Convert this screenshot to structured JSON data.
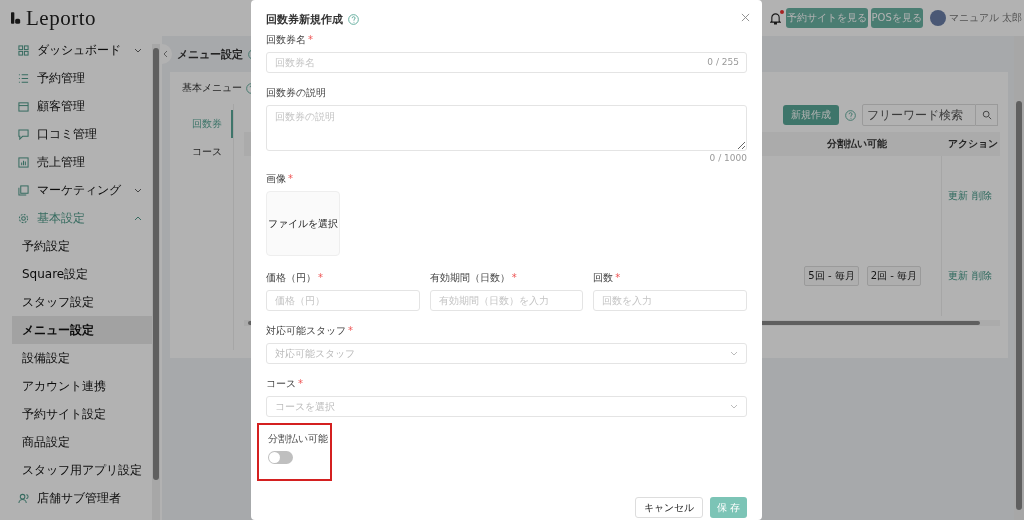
{
  "header": {
    "logo": "Leporto",
    "has_notification": true,
    "buttons": [
      "予約サイトを見る",
      "POSを見る"
    ],
    "user_name": "マニュアル 太郎"
  },
  "sidebar": {
    "items": [
      {
        "label": "ダッシュボード",
        "expandable": true,
        "expanded": false,
        "active": false
      },
      {
        "label": "予約管理",
        "expandable": false,
        "active": false
      },
      {
        "label": "顧客管理",
        "expandable": false,
        "active": false
      },
      {
        "label": "口コミ管理",
        "expandable": false,
        "active": false
      },
      {
        "label": "売上管理",
        "expandable": false,
        "active": false
      },
      {
        "label": "マーケティング",
        "expandable": true,
        "expanded": false,
        "active": false
      },
      {
        "label": "基本設定",
        "expandable": true,
        "expanded": true,
        "active": true,
        "children": [
          {
            "label": "予約設定",
            "selected": false
          },
          {
            "label": "Square設定",
            "selected": false
          },
          {
            "label": "スタッフ設定",
            "selected": false
          },
          {
            "label": "メニュー設定",
            "selected": true
          },
          {
            "label": "設備設定",
            "selected": false
          },
          {
            "label": "アカウント連携",
            "selected": false
          },
          {
            "label": "予約サイト設定",
            "selected": false
          },
          {
            "label": "商品設定",
            "selected": false
          },
          {
            "label": "スタッフ用アプリ設定",
            "selected": false
          }
        ]
      },
      {
        "label": "店舗サブ管理者",
        "expandable": false,
        "active": false
      }
    ]
  },
  "page": {
    "title": "メニュー設定",
    "section_tab": "基本メニュー",
    "tabs": [
      {
        "label": "回数券",
        "selected": true
      },
      {
        "label": "コース",
        "selected": false
      }
    ],
    "new_button": "新規作成",
    "search": {
      "placeholder": "フリーワード検索"
    },
    "table": {
      "columns": [
        "分割払い可能",
        "アクション"
      ],
      "rows": [
        {
          "installments": [],
          "actions": [
            "更新",
            "削除"
          ]
        },
        {
          "installments": [
            "5回 - 毎月",
            "2回 - 毎月"
          ],
          "actions": [
            "更新",
            "削除"
          ]
        }
      ]
    }
  },
  "dialog": {
    "title": "回数券新規作成",
    "name": {
      "label": "回数券名",
      "required_mark": "*",
      "placeholder": "回数券名",
      "counter": "0 / 255"
    },
    "description": {
      "label": "回数券の説明",
      "placeholder": "回数券の説明",
      "counter": "0 / 1000"
    },
    "image": {
      "label": "画像",
      "required_mark": "*",
      "button": "ファイルを選択"
    },
    "row_fields": [
      {
        "label": "価格（円）",
        "required_mark": "*",
        "placeholder": "価格（円）"
      },
      {
        "label": "有効期間（日数）",
        "required_mark": "*",
        "placeholder": "有効期間（日数）を入力"
      },
      {
        "label": "回数",
        "required_mark": "*",
        "placeholder": "回数を入力"
      }
    ],
    "selects": [
      {
        "label": "対応可能スタッフ",
        "required_mark": "*",
        "placeholder": "対応可能スタッフ"
      },
      {
        "label": "コース",
        "required_mark": "*",
        "placeholder": "コースを選択"
      }
    ],
    "installment": {
      "label": "分割払い可能",
      "on": false,
      "highlighted": true
    },
    "buttons": {
      "cancel": "キャンセル",
      "save": "保 存"
    }
  }
}
